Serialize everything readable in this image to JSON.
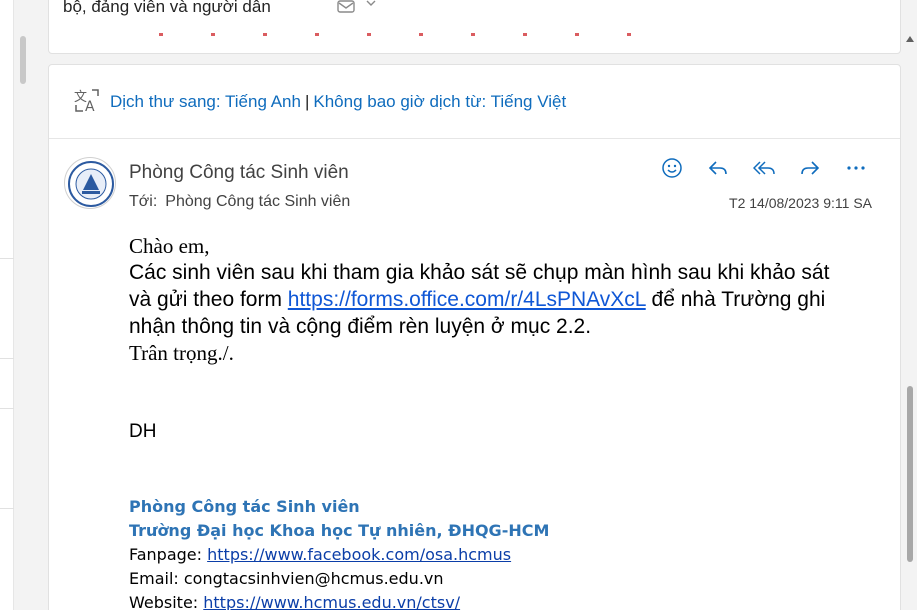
{
  "prev_message": {
    "subject_fragment": "bộ, đảng viên và người dân"
  },
  "translation_bar": {
    "translate_to": "Dịch thư sang: Tiếng Anh",
    "separator": "|",
    "never_translate": "Không bao giờ dịch từ: Tiếng Việt"
  },
  "message": {
    "sender": "Phòng Công tác Sinh viên",
    "to_label": "Tới:",
    "to_value": "Phòng Công tác Sinh viên",
    "date": "T2 14/08/2023 9:11 SA",
    "actions": [
      "smiley-icon",
      "reply-icon",
      "reply-all-icon",
      "forward-icon",
      "more-icon"
    ],
    "greeting": "Chào em,",
    "para_before_link": "Các sinh viên sau khi tham gia khảo sát sẽ chụp màn hình sau khi khảo sát và gửi theo form ",
    "form_link": "https://forms.office.com/r/4LsPNAvXcL",
    "para_after_link": " để nhà Trường ghi nhận thông tin và cộng điểm rèn luyện ở mục 2.2.",
    "closing": "Trân trọng./.",
    "initials": "DH"
  },
  "signature": {
    "org": "Phòng Công tác Sinh viên",
    "school": "Trường Đại học Khoa học Tự nhiên, ĐHQG-HCM",
    "fanpage_label": "Fanpage: ",
    "fanpage_url": "https://www.facebook.com/osa.hcmus",
    "email_label": "Email: ",
    "email_value": "congtacsinhvien@hcmus.edu.vn",
    "website_label": "Website: ",
    "website_url": "https://www.hcmus.edu.vn/ctsv/"
  },
  "colors": {
    "link_blue": "#0f6cbd",
    "signature_blue": "#2e74b5"
  }
}
